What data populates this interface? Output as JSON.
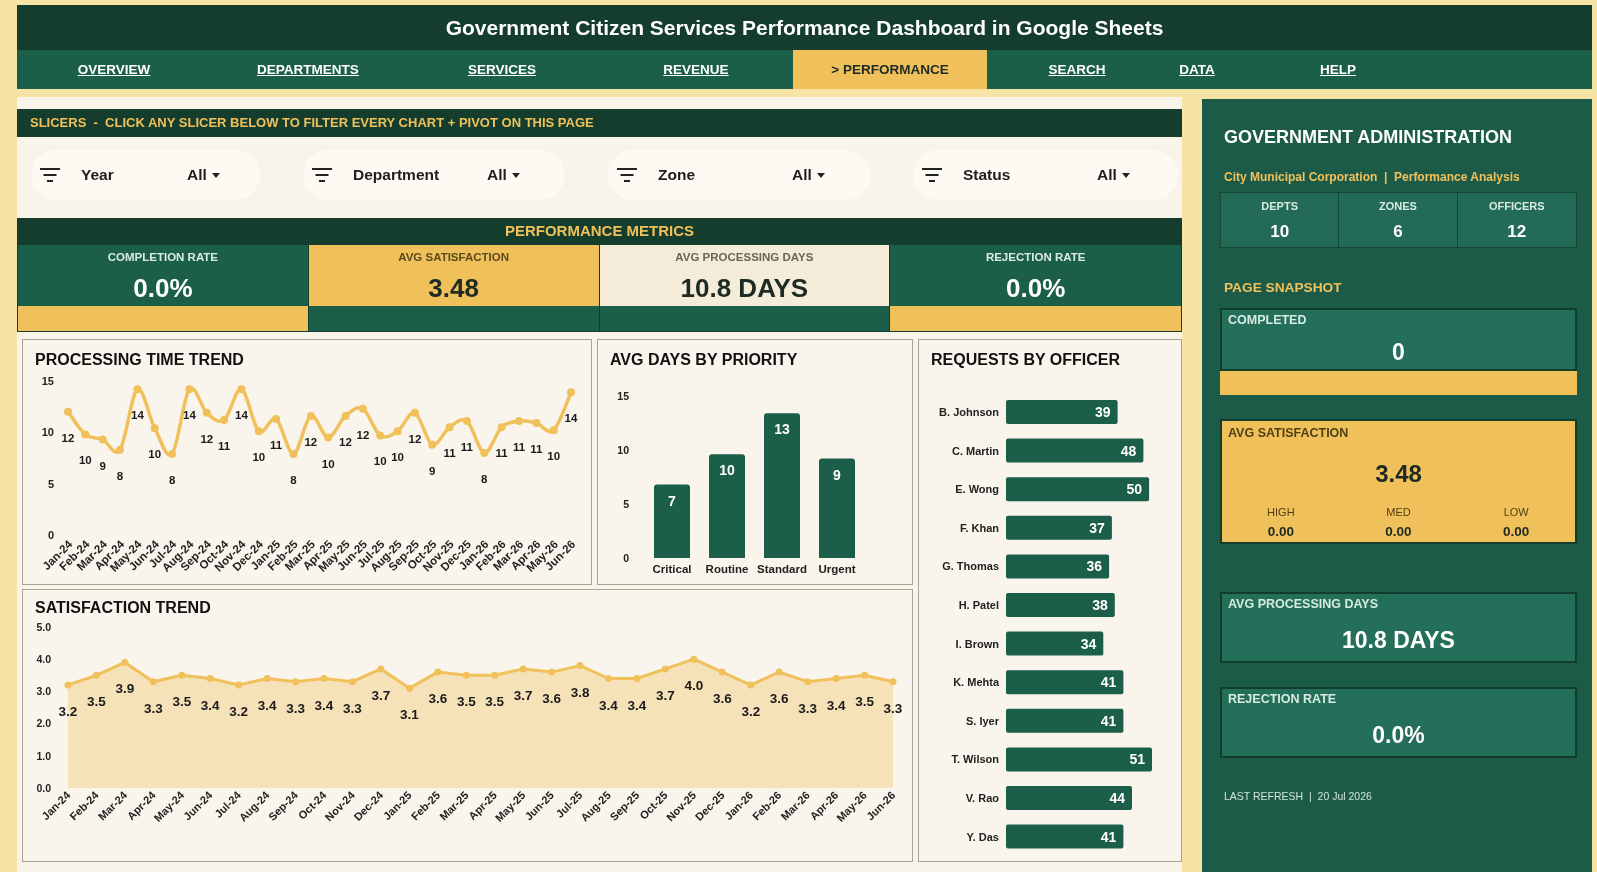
{
  "header": {
    "title": "Government Citizen Services Performance Dashboard in Google Sheets"
  },
  "nav": [
    {
      "label": "OVERVIEW",
      "selected": false
    },
    {
      "label": "DEPARTMENTS",
      "selected": false
    },
    {
      "label": "SERVICES",
      "selected": false
    },
    {
      "label": "REVENUE",
      "selected": false
    },
    {
      "label": "> PERFORMANCE",
      "selected": true
    },
    {
      "label": "SEARCH",
      "selected": false
    },
    {
      "label": "DATA",
      "selected": false
    },
    {
      "label": "HELP",
      "selected": false
    }
  ],
  "slicer_banner": {
    "text": "SLICERS  -  CLICK ANY SLICER BELOW TO FILTER EVERY CHART + PIVOT ON THIS PAGE"
  },
  "slicers": [
    {
      "label": "Year",
      "value": "All"
    },
    {
      "label": "Department",
      "value": "All"
    },
    {
      "label": "Zone",
      "value": "All"
    },
    {
      "label": "Status",
      "value": "All"
    }
  ],
  "metrics": {
    "title": "PERFORMANCE METRICS",
    "tiles": [
      {
        "kind": "dark",
        "label": "COMPLETION RATE",
        "value": "0.0%"
      },
      {
        "kind": "gold",
        "label": "AVG SATISFACTION",
        "value": "3.48"
      },
      {
        "kind": "light",
        "label": "AVG PROCESSING DAYS",
        "value": "10.8 DAYS"
      },
      {
        "kind": "dark",
        "label": "REJECTION RATE",
        "value": "0.0%"
      }
    ]
  },
  "charts": [
    {
      "chart_data": {
        "type": "line",
        "title": "PROCESSING TIME TREND",
        "categories": [
          "Jan-24",
          "Feb-24",
          "Mar-24",
          "Apr-24",
          "May-24",
          "Jun-24",
          "Jul-24",
          "Aug-24",
          "Sep-24",
          "Oct-24",
          "Nov-24",
          "Dec-24",
          "Jan-25",
          "Feb-25",
          "Mar-25",
          "Apr-25",
          "May-25",
          "Jun-25",
          "Jul-25",
          "Aug-25",
          "Sep-25",
          "Oct-25",
          "Nov-25",
          "Dec-25",
          "Jan-26",
          "Feb-26",
          "Mar-26",
          "Apr-26",
          "May-26",
          "Jun-26"
        ],
        "series": [
          {
            "color": "#f0c15a",
            "marker": true,
            "values": [
              12.0,
              9.8,
              9.3,
              8.3,
              14.2,
              10.4,
              7.9,
              14.2,
              11.9,
              11.2,
              14.2,
              10.1,
              11.3,
              7.9,
              11.6,
              9.5,
              11.6,
              12.3,
              9.7,
              10.1,
              11.9,
              8.8,
              10.5,
              11.1,
              8.0,
              10.5,
              11.1,
              10.9,
              10.2,
              13.9
            ]
          }
        ],
        "ylim": [
          0,
          15
        ],
        "yticks": [
          0,
          5,
          10,
          15
        ],
        "value_labels": [
          "12",
          "10",
          "9",
          "8",
          "14",
          "10",
          "8",
          "14",
          "12",
          "11",
          "14",
          "10",
          "11",
          "8",
          "12",
          "10",
          "12",
          "12",
          "10",
          "10",
          "12",
          "9",
          "11",
          "11",
          "8",
          "11",
          "11",
          "11",
          "10",
          "14"
        ]
      }
    },
    {
      "chart_data": {
        "type": "bar",
        "title": "AVG DAYS BY PRIORITY",
        "categories": [
          "Critical",
          "Routine",
          "Standard",
          "Urgent"
        ],
        "series": [
          {
            "color": "#1b5e4a",
            "values": [
              6.8,
              9.6,
              13.4,
              9.2
            ]
          }
        ],
        "ylim": [
          0,
          15
        ],
        "yticks": [
          0,
          5,
          10,
          15
        ],
        "value_labels": [
          "7",
          "10",
          "13",
          "9"
        ]
      }
    },
    {
      "chart_data": {
        "type": "bar",
        "orientation": "horizontal",
        "title": "REQUESTS BY OFFICER",
        "categories": [
          "B. Johnson",
          "C. Martin",
          "E. Wong",
          "F. Khan",
          "G. Thomas",
          "H. Patel",
          "I. Brown",
          "K. Mehta",
          "S. Iyer",
          "T. Wilson",
          "V. Rao",
          "Y. Das"
        ],
        "series": [
          {
            "color": "#1b5e4a",
            "values": [
              39,
              48,
              50,
              37,
              36,
              38,
              34,
              41,
              41,
              51,
              44,
              41
            ]
          }
        ],
        "data_labels": true
      }
    },
    {
      "chart_data": {
        "type": "area",
        "title": "SATISFACTION TREND",
        "categories": [
          "Jan-24",
          "Feb-24",
          "Mar-24",
          "Apr-24",
          "May-24",
          "Jun-24",
          "Jul-24",
          "Aug-24",
          "Sep-24",
          "Oct-24",
          "Nov-24",
          "Dec-24",
          "Jan-25",
          "Feb-25",
          "Mar-25",
          "Apr-25",
          "May-25",
          "Jun-25",
          "Jul-25",
          "Aug-25",
          "Sep-25",
          "Oct-25",
          "Nov-25",
          "Dec-25",
          "Jan-26",
          "Feb-26",
          "Mar-26",
          "Apr-26",
          "May-26",
          "Jun-26"
        ],
        "series": [
          {
            "color": "#f0c15a",
            "marker": true,
            "values": [
              3.2,
              3.5,
              3.9,
              3.3,
              3.5,
              3.4,
              3.2,
              3.4,
              3.3,
              3.4,
              3.3,
              3.7,
              3.1,
              3.6,
              3.5,
              3.5,
              3.7,
              3.6,
              3.8,
              3.4,
              3.4,
              3.7,
              4.0,
              3.6,
              3.2,
              3.6,
              3.3,
              3.4,
              3.5,
              3.3
            ]
          }
        ],
        "ylim": [
          0,
          5
        ],
        "yticks": [
          {
            "value": 0,
            "label": "0.0"
          },
          {
            "value": 1,
            "label": "1.0"
          },
          {
            "value": 2,
            "label": "2.0"
          },
          {
            "value": 3,
            "label": "3.0"
          },
          {
            "value": 4,
            "label": "4.0"
          },
          {
            "value": 5,
            "label": "5.0"
          }
        ],
        "value_labels": [
          "3.2",
          "3.5",
          "3.9",
          "3.3",
          "3.5",
          "3.4",
          "3.2",
          "3.4",
          "3.3",
          "3.4",
          "3.3",
          "3.7",
          "3.1",
          "3.6",
          "3.5",
          "3.5",
          "3.7",
          "3.6",
          "3.8",
          "3.4",
          "3.4",
          "3.7",
          "4.0",
          "3.6",
          "3.2",
          "3.6",
          "3.3",
          "3.4",
          "3.5",
          "3.3"
        ]
      }
    }
  ],
  "admin_panel": {
    "title": "GOVERNMENT ADMINISTRATION",
    "subtitle": "City Municipal Corporation  |  Performance Analysis",
    "stats": [
      {
        "label": "DEPTS",
        "value": "10"
      },
      {
        "label": "ZONES",
        "value": "6"
      },
      {
        "label": "OFFICERS",
        "value": "12"
      }
    ],
    "snapshot_title": "PAGE SNAPSHOT",
    "snapshot": [
      {
        "kind": "barred",
        "label": "COMPLETED",
        "value": "0"
      },
      {
        "kind": "gold",
        "label": "AVG SATISFACTION",
        "value": "3.48",
        "breakdown": [
          {
            "label": "HIGH",
            "value": "0.00"
          },
          {
            "label": "MED",
            "value": "0.00"
          },
          {
            "label": "LOW",
            "value": "0.00"
          }
        ]
      },
      {
        "kind": "plain",
        "label": "AVG PROCESSING DAYS",
        "value": "10.8 DAYS"
      },
      {
        "kind": "plain",
        "label": "REJECTION RATE",
        "value": "0.0%"
      }
    ],
    "footer": "LAST REFRESH  |  20 Jul 2026"
  }
}
